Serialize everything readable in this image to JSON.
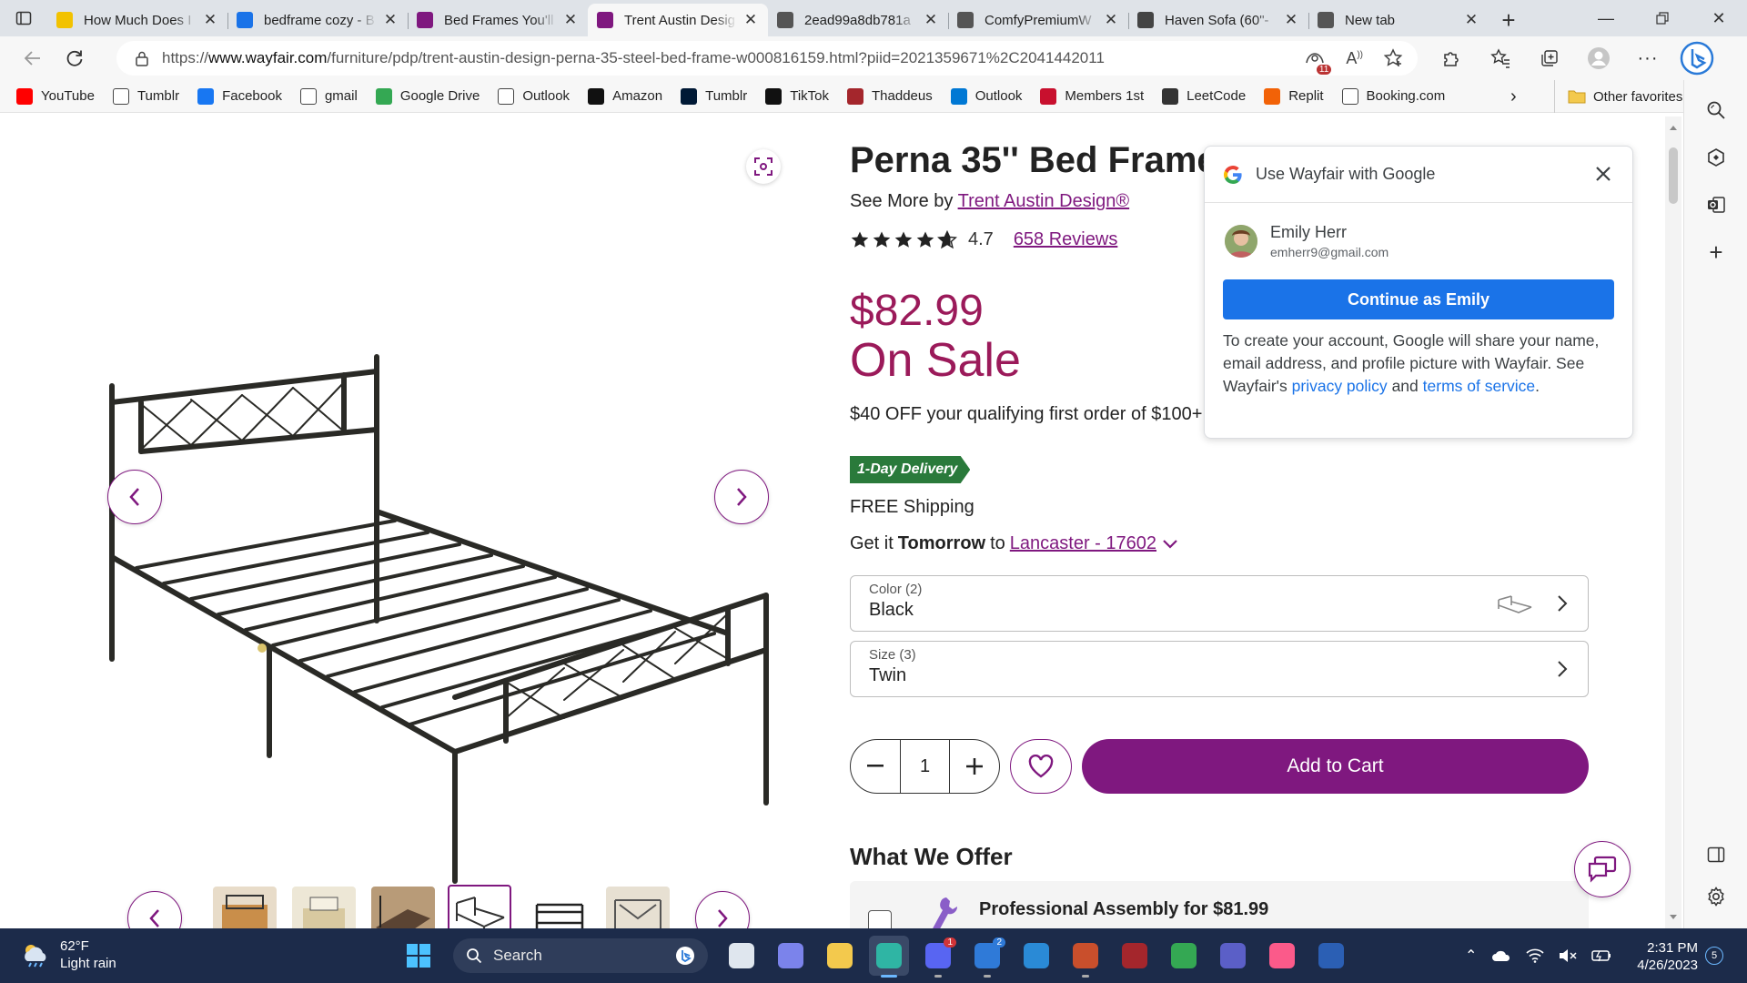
{
  "browser": {
    "tabs": [
      {
        "title": "How Much Does I",
        "icon": "norton-icon",
        "color": "#f2c200"
      },
      {
        "title": "bedframe cozy - B",
        "icon": "bing-search-icon",
        "color": "#1a73e8"
      },
      {
        "title": "Bed Frames You'll",
        "icon": "wayfair-icon",
        "color": "#7f187f"
      },
      {
        "title": "Trent Austin Desig",
        "icon": "wayfair-icon",
        "color": "#7f187f",
        "active": true
      },
      {
        "title": "2ead99a8db781a",
        "icon": "document-icon",
        "color": "#555555"
      },
      {
        "title": "ComfyPremiumW",
        "icon": "document-icon",
        "color": "#555555"
      },
      {
        "title": "Haven Sofa (60\"-",
        "icon": "west-elm-icon",
        "color": "#444444"
      },
      {
        "title": "New tab",
        "icon": "newtab-icon",
        "color": "#555555"
      }
    ],
    "url_prefix": "https://",
    "url_domain": "www.wayfair.com",
    "url_path": "/furniture/pdp/trent-austin-design-perna-35-steel-bed-frame-w000816159.html?piid=2021359671%2C2041442011",
    "tracking_badge": "11",
    "bookmarks": [
      {
        "label": "YouTube",
        "icon": "youtube-icon",
        "color": "#ff0000"
      },
      {
        "label": "Tumblr",
        "icon": "page-icon",
        "color": "#ffffff"
      },
      {
        "label": "Facebook",
        "icon": "facebook-icon",
        "color": "#1877f2"
      },
      {
        "label": "gmail",
        "icon": "page-icon",
        "color": "#ffffff"
      },
      {
        "label": "Google Drive",
        "icon": "drive-icon",
        "color": "#34a853"
      },
      {
        "label": "Outlook",
        "icon": "page-icon",
        "color": "#ffffff"
      },
      {
        "label": "Amazon",
        "icon": "amazon-icon",
        "color": "#111111"
      },
      {
        "label": "Tumblr",
        "icon": "tumblr-icon",
        "color": "#001935"
      },
      {
        "label": "TikTok",
        "icon": "tiktok-icon",
        "color": "#111111"
      },
      {
        "label": "Thaddeus",
        "icon": "my-icon",
        "color": "#a4262c"
      },
      {
        "label": "Outlook",
        "icon": "outlook-icon",
        "color": "#0078d4"
      },
      {
        "label": "Members 1st",
        "icon": "members-icon",
        "color": "#c8102e"
      },
      {
        "label": "LeetCode",
        "icon": "leetcode-icon",
        "color": "#333333"
      },
      {
        "label": "Replit",
        "icon": "replit-icon",
        "color": "#f26207"
      },
      {
        "label": "Booking.com",
        "icon": "page-icon",
        "color": "#ffffff"
      }
    ],
    "other_favorites": "Other favorites"
  },
  "product": {
    "title": "Perna 35'' Bed Frame",
    "see_more_prefix": "See More by",
    "brand": "Trent Austin Design®",
    "rating": "4.7",
    "reviews": "658 Reviews",
    "price": "$82.99",
    "sale_label": "On Sale",
    "promo": "$40 OFF your qualifying first order of $100+",
    "delivery_badge": "1-Day Delivery",
    "free_shipping": "FREE Shipping",
    "get_it_prefix": "Get it",
    "get_it_when": "Tomorrow",
    "get_it_to": "to",
    "location": "Lancaster - 17602",
    "color_label": "Color (2)",
    "color_value": "Black",
    "size_label": "Size (3)",
    "size_value": "Twin",
    "quantity": "1",
    "add_to_cart": "Add to Cart",
    "what_we_offer": "What We Offer",
    "assembly": "Professional Assembly for $81.99",
    "thumbnail_count": 6,
    "selected_thumbnail": 4,
    "accent_color": "#7f187f",
    "price_color": "#9b1a5a"
  },
  "google_popup": {
    "title": "Use Wayfair with Google",
    "user_name": "Emily Herr",
    "user_email": "emherr9@gmail.com",
    "continue_label": "Continue as Emily",
    "info_text": "To create your account, Google will share your name, email address, and profile picture with Wayfair. See Wayfair's",
    "privacy_link": "privacy policy",
    "and_text": "and",
    "terms_link": "terms of service",
    "period": "."
  },
  "taskbar": {
    "temperature": "62°F",
    "weather": "Light rain",
    "search_placeholder": "Search",
    "apps": [
      {
        "name": "task-view-icon",
        "badge": ""
      },
      {
        "name": "teams-chat-icon",
        "badge": ""
      },
      {
        "name": "file-explorer-icon",
        "badge": ""
      },
      {
        "name": "edge-icon",
        "badge": "",
        "active": true
      },
      {
        "name": "discord-icon",
        "badge": "1"
      },
      {
        "name": "mail-icon",
        "badge": "2"
      },
      {
        "name": "vscode-icon",
        "badge": ""
      },
      {
        "name": "powerpoint-icon",
        "badge": ""
      },
      {
        "name": "my-icon",
        "badge": ""
      },
      {
        "name": "google-drive-icon",
        "badge": ""
      },
      {
        "name": "teams-icon",
        "badge": ""
      },
      {
        "name": "itunes-icon",
        "badge": ""
      },
      {
        "name": "word-icon",
        "badge": ""
      }
    ],
    "time": "2:31 PM",
    "date": "4/26/2023",
    "notifications": "5"
  }
}
